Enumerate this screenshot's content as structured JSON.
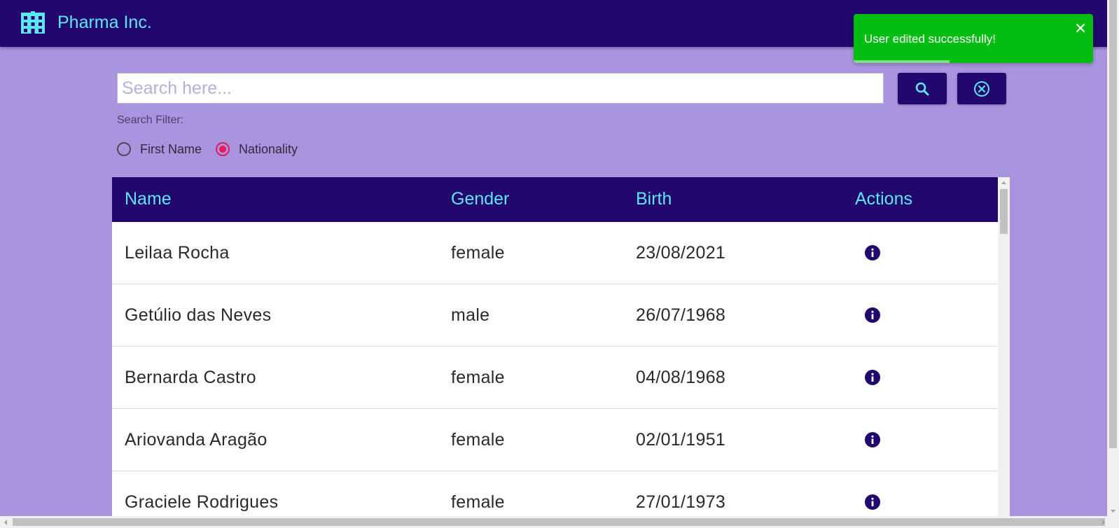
{
  "app": {
    "brand": "Pharma Inc.",
    "logo_icon": "building-icon"
  },
  "toast": {
    "message": "User edited successfully!",
    "close_icon": "close-icon",
    "color": "#04bd12",
    "progress": 0.4
  },
  "search": {
    "placeholder": "Search here...",
    "value": "",
    "search_button_icon": "search-icon",
    "clear_button_icon": "cancel-circle-icon"
  },
  "filter": {
    "label": "Search Filter:",
    "options": [
      {
        "label": "First Name",
        "checked": false
      },
      {
        "label": "Nationality",
        "checked": true
      }
    ]
  },
  "table": {
    "columns": [
      "Name",
      "Gender",
      "Birth",
      "Actions"
    ],
    "rows": [
      {
        "name": "Leilaa Rocha",
        "gender": "female",
        "birth": "23/08/2021"
      },
      {
        "name": "Getúlio das Neves",
        "gender": "male",
        "birth": "26/07/1968"
      },
      {
        "name": "Bernarda Castro",
        "gender": "female",
        "birth": "04/08/1968"
      },
      {
        "name": "Ariovanda Aragão",
        "gender": "female",
        "birth": "02/01/1951"
      },
      {
        "name": "Graciele Rodrigues",
        "gender": "female",
        "birth": "27/01/1973"
      }
    ],
    "action_icon": "info-icon"
  },
  "colors": {
    "primary": "#21076e",
    "accent": "#5ee6f4",
    "background": "#a994df",
    "radio_selected": "#e8185c"
  }
}
